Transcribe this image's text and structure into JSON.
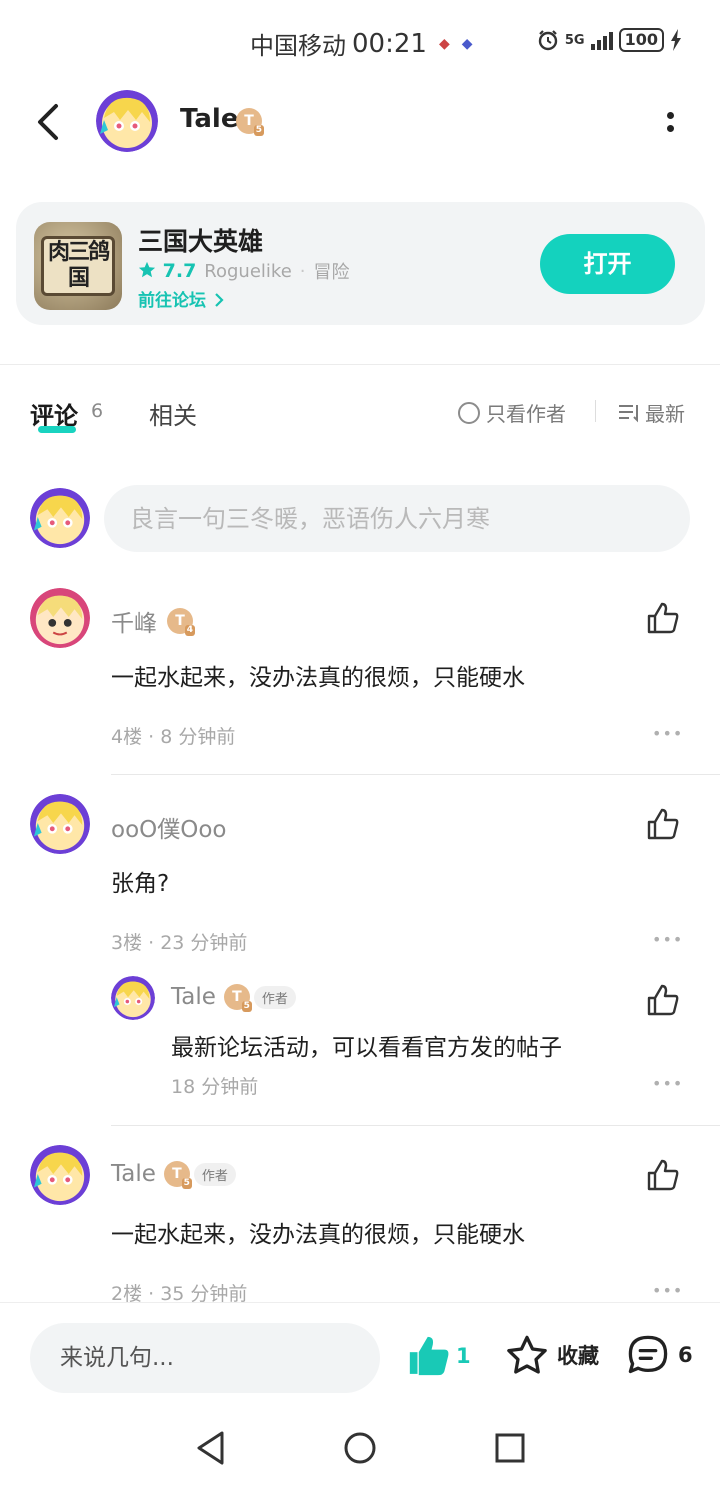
{
  "status_bar": {
    "carrier": "中国移动",
    "time": "00:21",
    "network": "5G",
    "battery": "100"
  },
  "header": {
    "user_name": "Tale",
    "level_badge": "T",
    "level_num": "5"
  },
  "game": {
    "title": "三国大英雄",
    "icon_text": "肉三鸽国",
    "rating": "7.7",
    "tag1": "Roguelike",
    "tag2": "冒险",
    "forum_link": "前往论坛",
    "open_button": "打开"
  },
  "tabs": {
    "comments_label": "评论",
    "comments_count": "6",
    "related_label": "相关",
    "author_only": "只看作者",
    "sort_label": "最新"
  },
  "composer": {
    "placeholder": "良言一句三冬暖，恶语伤人六月寒"
  },
  "comments": [
    {
      "name": "千峰",
      "level_num": "4",
      "text": "一起水起来，没办法真的很烦，只能硬水",
      "meta": "4楼 · 8 分钟前"
    },
    {
      "name": "ooO僕Ooo",
      "text": "张角?",
      "meta": "3楼 · 23 分钟前",
      "reply": {
        "name": "Tale",
        "level_num": "5",
        "author_tag": "作者",
        "text": "最新论坛活动，可以看看官方发的帖子",
        "meta": "18 分钟前"
      }
    },
    {
      "name": "Tale",
      "level_num": "5",
      "author_tag": "作者",
      "text": "一起水起来，没办法真的很烦，只能硬水",
      "meta": "2楼 · 35 分钟前"
    }
  ],
  "bottom_bar": {
    "reply_placeholder": "来说几句...",
    "like_count": "1",
    "favorite_label": "收藏",
    "comment_count": "6"
  },
  "colors": {
    "accent": "#14d2be",
    "avatar_ring": "#6c3fd6",
    "level_badge": "#e6b98a"
  },
  "icons": [
    "back-arrow-icon",
    "more-vertical-icon",
    "star-icon",
    "chevron-right-icon",
    "thumbs-up-icon",
    "ellipsis-icon",
    "favorite-star-icon",
    "comment-bubble-icon",
    "nav-back-icon",
    "nav-home-icon",
    "nav-recent-icon"
  ]
}
